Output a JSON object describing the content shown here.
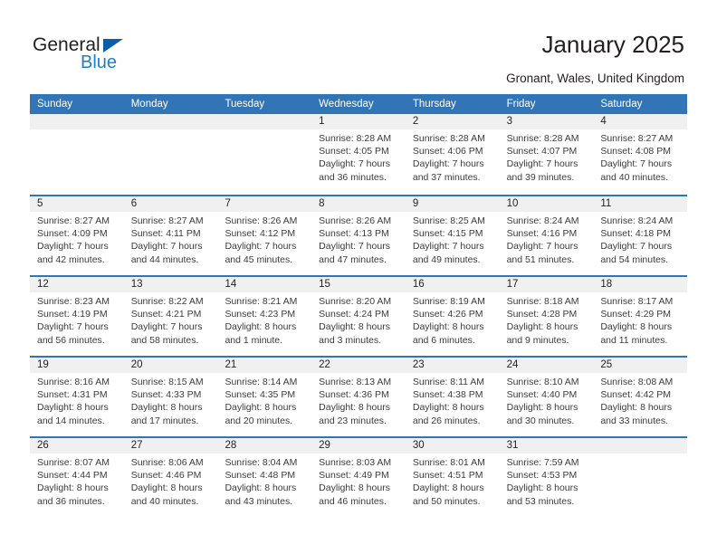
{
  "brand": {
    "name_part1": "General",
    "name_part2": "Blue",
    "logo_triangle": "triangle-icon",
    "accent_color": "#1f7ec4"
  },
  "header": {
    "title": "January 2025",
    "subtitle": "Gronant, Wales, United Kingdom"
  },
  "calendar": {
    "header_bg": "#3275b7",
    "row_divider_color": "#3275b7",
    "day_band_bg": "#f0f0f0",
    "weekdays": [
      "Sunday",
      "Monday",
      "Tuesday",
      "Wednesday",
      "Thursday",
      "Friday",
      "Saturday"
    ],
    "weeks": [
      [
        {
          "day": "",
          "line1": "",
          "line2": "",
          "line3": "",
          "line4": ""
        },
        {
          "day": "",
          "line1": "",
          "line2": "",
          "line3": "",
          "line4": ""
        },
        {
          "day": "",
          "line1": "",
          "line2": "",
          "line3": "",
          "line4": ""
        },
        {
          "day": "1",
          "line1": "Sunrise: 8:28 AM",
          "line2": "Sunset: 4:05 PM",
          "line3": "Daylight: 7 hours",
          "line4": "and 36 minutes."
        },
        {
          "day": "2",
          "line1": "Sunrise: 8:28 AM",
          "line2": "Sunset: 4:06 PM",
          "line3": "Daylight: 7 hours",
          "line4": "and 37 minutes."
        },
        {
          "day": "3",
          "line1": "Sunrise: 8:28 AM",
          "line2": "Sunset: 4:07 PM",
          "line3": "Daylight: 7 hours",
          "line4": "and 39 minutes."
        },
        {
          "day": "4",
          "line1": "Sunrise: 8:27 AM",
          "line2": "Sunset: 4:08 PM",
          "line3": "Daylight: 7 hours",
          "line4": "and 40 minutes."
        }
      ],
      [
        {
          "day": "5",
          "line1": "Sunrise: 8:27 AM",
          "line2": "Sunset: 4:09 PM",
          "line3": "Daylight: 7 hours",
          "line4": "and 42 minutes."
        },
        {
          "day": "6",
          "line1": "Sunrise: 8:27 AM",
          "line2": "Sunset: 4:11 PM",
          "line3": "Daylight: 7 hours",
          "line4": "and 44 minutes."
        },
        {
          "day": "7",
          "line1": "Sunrise: 8:26 AM",
          "line2": "Sunset: 4:12 PM",
          "line3": "Daylight: 7 hours",
          "line4": "and 45 minutes."
        },
        {
          "day": "8",
          "line1": "Sunrise: 8:26 AM",
          "line2": "Sunset: 4:13 PM",
          "line3": "Daylight: 7 hours",
          "line4": "and 47 minutes."
        },
        {
          "day": "9",
          "line1": "Sunrise: 8:25 AM",
          "line2": "Sunset: 4:15 PM",
          "line3": "Daylight: 7 hours",
          "line4": "and 49 minutes."
        },
        {
          "day": "10",
          "line1": "Sunrise: 8:24 AM",
          "line2": "Sunset: 4:16 PM",
          "line3": "Daylight: 7 hours",
          "line4": "and 51 minutes."
        },
        {
          "day": "11",
          "line1": "Sunrise: 8:24 AM",
          "line2": "Sunset: 4:18 PM",
          "line3": "Daylight: 7 hours",
          "line4": "and 54 minutes."
        }
      ],
      [
        {
          "day": "12",
          "line1": "Sunrise: 8:23 AM",
          "line2": "Sunset: 4:19 PM",
          "line3": "Daylight: 7 hours",
          "line4": "and 56 minutes."
        },
        {
          "day": "13",
          "line1": "Sunrise: 8:22 AM",
          "line2": "Sunset: 4:21 PM",
          "line3": "Daylight: 7 hours",
          "line4": "and 58 minutes."
        },
        {
          "day": "14",
          "line1": "Sunrise: 8:21 AM",
          "line2": "Sunset: 4:23 PM",
          "line3": "Daylight: 8 hours",
          "line4": "and 1 minute."
        },
        {
          "day": "15",
          "line1": "Sunrise: 8:20 AM",
          "line2": "Sunset: 4:24 PM",
          "line3": "Daylight: 8 hours",
          "line4": "and 3 minutes."
        },
        {
          "day": "16",
          "line1": "Sunrise: 8:19 AM",
          "line2": "Sunset: 4:26 PM",
          "line3": "Daylight: 8 hours",
          "line4": "and 6 minutes."
        },
        {
          "day": "17",
          "line1": "Sunrise: 8:18 AM",
          "line2": "Sunset: 4:28 PM",
          "line3": "Daylight: 8 hours",
          "line4": "and 9 minutes."
        },
        {
          "day": "18",
          "line1": "Sunrise: 8:17 AM",
          "line2": "Sunset: 4:29 PM",
          "line3": "Daylight: 8 hours",
          "line4": "and 11 minutes."
        }
      ],
      [
        {
          "day": "19",
          "line1": "Sunrise: 8:16 AM",
          "line2": "Sunset: 4:31 PM",
          "line3": "Daylight: 8 hours",
          "line4": "and 14 minutes."
        },
        {
          "day": "20",
          "line1": "Sunrise: 8:15 AM",
          "line2": "Sunset: 4:33 PM",
          "line3": "Daylight: 8 hours",
          "line4": "and 17 minutes."
        },
        {
          "day": "21",
          "line1": "Sunrise: 8:14 AM",
          "line2": "Sunset: 4:35 PM",
          "line3": "Daylight: 8 hours",
          "line4": "and 20 minutes."
        },
        {
          "day": "22",
          "line1": "Sunrise: 8:13 AM",
          "line2": "Sunset: 4:36 PM",
          "line3": "Daylight: 8 hours",
          "line4": "and 23 minutes."
        },
        {
          "day": "23",
          "line1": "Sunrise: 8:11 AM",
          "line2": "Sunset: 4:38 PM",
          "line3": "Daylight: 8 hours",
          "line4": "and 26 minutes."
        },
        {
          "day": "24",
          "line1": "Sunrise: 8:10 AM",
          "line2": "Sunset: 4:40 PM",
          "line3": "Daylight: 8 hours",
          "line4": "and 30 minutes."
        },
        {
          "day": "25",
          "line1": "Sunrise: 8:08 AM",
          "line2": "Sunset: 4:42 PM",
          "line3": "Daylight: 8 hours",
          "line4": "and 33 minutes."
        }
      ],
      [
        {
          "day": "26",
          "line1": "Sunrise: 8:07 AM",
          "line2": "Sunset: 4:44 PM",
          "line3": "Daylight: 8 hours",
          "line4": "and 36 minutes."
        },
        {
          "day": "27",
          "line1": "Sunrise: 8:06 AM",
          "line2": "Sunset: 4:46 PM",
          "line3": "Daylight: 8 hours",
          "line4": "and 40 minutes."
        },
        {
          "day": "28",
          "line1": "Sunrise: 8:04 AM",
          "line2": "Sunset: 4:48 PM",
          "line3": "Daylight: 8 hours",
          "line4": "and 43 minutes."
        },
        {
          "day": "29",
          "line1": "Sunrise: 8:03 AM",
          "line2": "Sunset: 4:49 PM",
          "line3": "Daylight: 8 hours",
          "line4": "and 46 minutes."
        },
        {
          "day": "30",
          "line1": "Sunrise: 8:01 AM",
          "line2": "Sunset: 4:51 PM",
          "line3": "Daylight: 8 hours",
          "line4": "and 50 minutes."
        },
        {
          "day": "31",
          "line1": "Sunrise: 7:59 AM",
          "line2": "Sunset: 4:53 PM",
          "line3": "Daylight: 8 hours",
          "line4": "and 53 minutes."
        },
        {
          "day": "",
          "line1": "",
          "line2": "",
          "line3": "",
          "line4": ""
        }
      ]
    ]
  }
}
